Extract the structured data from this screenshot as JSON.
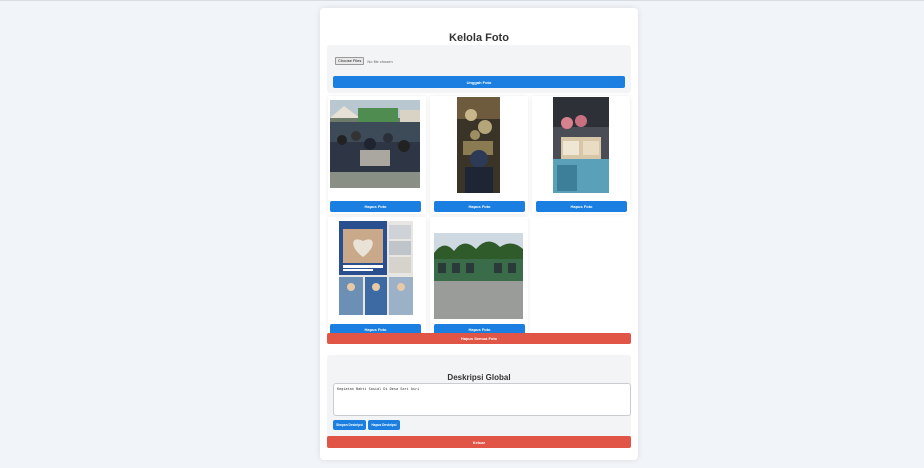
{
  "page_title": "Kelola Foto",
  "upload": {
    "choose_label": "Choose Files",
    "no_file_text": "No file chosen",
    "submit_label": "Unggah Foto"
  },
  "photos": [
    {
      "delete_label": "Hapus Foto"
    },
    {
      "delete_label": "Hapus Foto"
    },
    {
      "delete_label": "Hapus Foto"
    },
    {
      "delete_label": "Hapus Foto"
    },
    {
      "delete_label": "Hapus Foto"
    }
  ],
  "delete_all_label": "Hapus Semua Foto",
  "description": {
    "title": "Deskripsi Global",
    "value": "Kegiatan Bakti Sosial Di Desa Sari Asri",
    "save_label": "Simpan Deskripsi",
    "delete_label": "Hapus Deskripsi"
  },
  "logout_label": "Keluar",
  "colors": {
    "primary": "#1a7fe0",
    "danger": "#e05545",
    "background": "#f1f4f8"
  }
}
